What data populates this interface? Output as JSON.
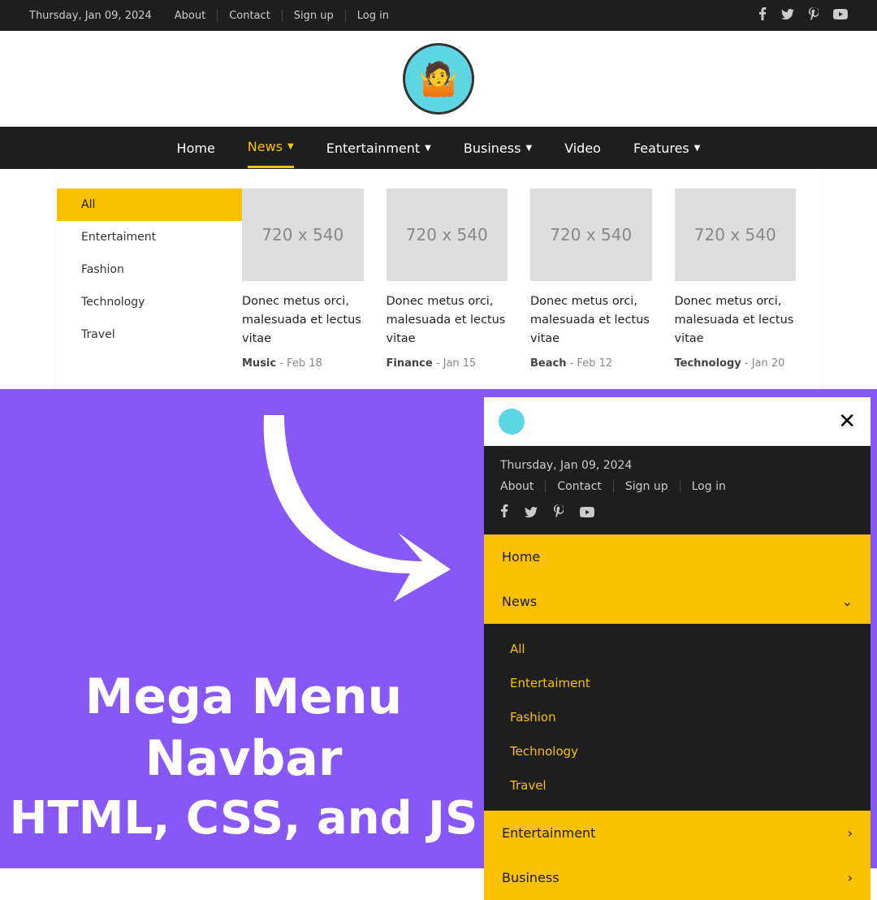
{
  "topbar": {
    "date": "Thursday, Jan 09, 2024",
    "about": "About",
    "contact": "Contact",
    "signup": "Sign up",
    "login": "Log in"
  },
  "nav": {
    "home": "Home",
    "news": "News",
    "entertainment": "Entertainment",
    "business": "Business",
    "video": "Video",
    "features": "Features"
  },
  "megaSide": {
    "all": "All",
    "entertainment": "Entertaiment",
    "fashion": "Fashion",
    "technology": "Technology",
    "travel": "Travel"
  },
  "cards": [
    {
      "img": "720 x 540",
      "title": "Donec metus orci, malesuada et lectus vitae",
      "cat": "Music",
      "date": "Feb 18"
    },
    {
      "img": "720 x 540",
      "title": "Donec metus orci, malesuada et lectus vitae",
      "cat": "Finance",
      "date": "Jan 15"
    },
    {
      "img": "720 x 540",
      "title": "Donec metus orci, malesuada et lectus vitae",
      "cat": "Beach",
      "date": "Feb 12"
    },
    {
      "img": "720 x 540",
      "title": "Donec metus orci, malesuada et lectus vitae",
      "cat": "Technology",
      "date": "Jan 20"
    }
  ],
  "hero": {
    "l1": "Mega Menu",
    "l2": "Navbar",
    "l3": "HTML, CSS, and JS"
  },
  "mobile": {
    "date": "Thursday, Jan 09, 2024",
    "about": "About",
    "contact": "Contact",
    "signup": "Sign up",
    "login": "Log in",
    "home": "Home",
    "news": "News",
    "sub": [
      "All",
      "Entertaiment",
      "Fashion",
      "Technology",
      "Travel"
    ],
    "entertainment": "Entertainment",
    "business": "Business"
  }
}
